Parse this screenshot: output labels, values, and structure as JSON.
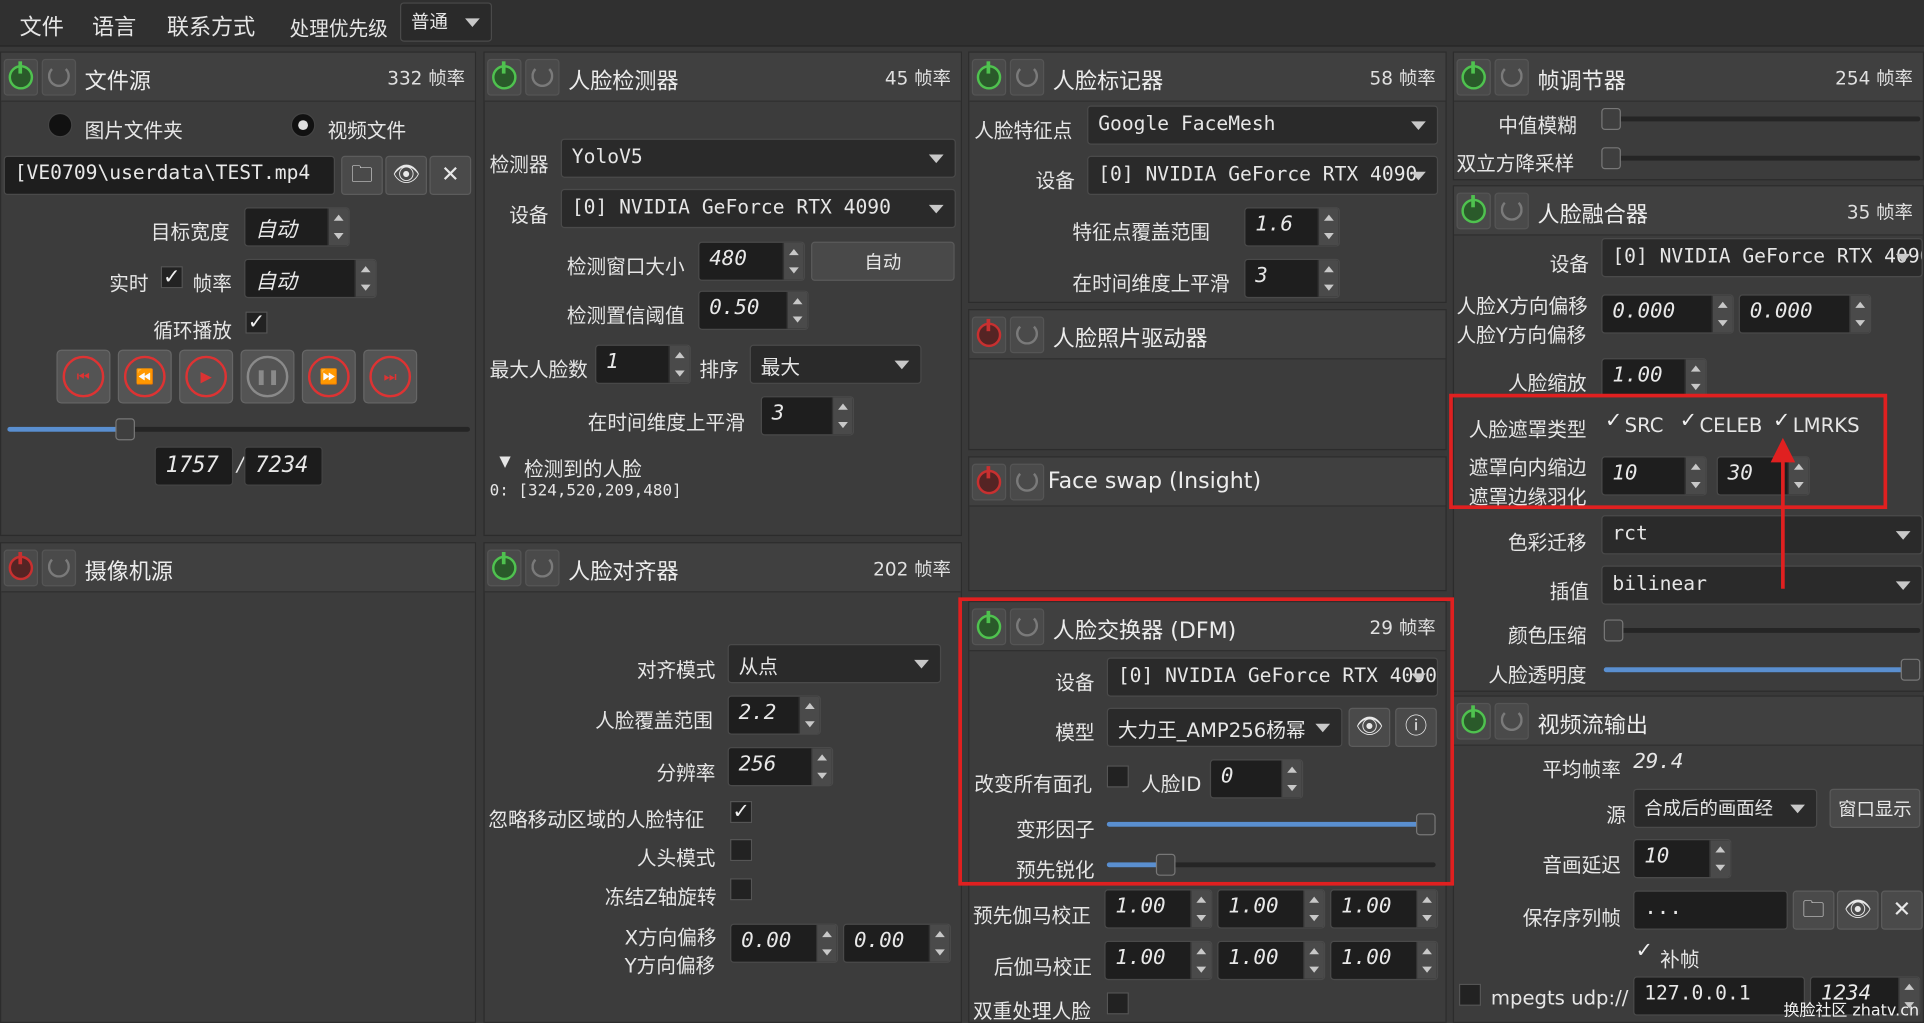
{
  "menubar": {
    "file": "文件",
    "language": "语言",
    "contact": "联系方式",
    "priority_label": "处理优先级",
    "priority_value": "普通"
  },
  "file_source": {
    "title": "文件源",
    "fps": "332 帧率",
    "radio_images": "图片文件夹",
    "radio_video": "视频文件",
    "path": "[VE0709\\userdata\\TEST.mp4",
    "target_width_label": "目标宽度",
    "target_width_value": "自动",
    "realtime_label": "实时",
    "fps_label": "帧率",
    "fps_value": "自动",
    "loop_label": "循环播放",
    "frame_current": "1757",
    "frame_sep": "/",
    "frame_total": "7234",
    "progress_fraction": 0.255
  },
  "camera_source": {
    "title": "摄像机源"
  },
  "face_detector": {
    "title": "人脸检测器",
    "fps": "45 帧率",
    "detector_label": "检测器",
    "detector_value": "YoloV5",
    "device_label": "设备",
    "device_value": "[0] NVIDIA GeForce RTX 4090",
    "window_label": "检测窗口大小",
    "window_value": "480",
    "auto_button": "自动",
    "threshold_label": "检测置信阈值",
    "threshold_value": "0.50",
    "max_faces_label": "最大人脸数",
    "max_faces_value": "1",
    "sort_label": "排序",
    "sort_value": "最大",
    "smooth_label": "在时间维度上平滑",
    "smooth_value": "3",
    "detected_label": "检测到的人脸",
    "detected_value": "0: [324,520,209,480]"
  },
  "face_aligner": {
    "title": "人脸对齐器",
    "fps": "202 帧率",
    "mode_label": "对齐模式",
    "mode_value": "从点",
    "coverage_label": "人脸覆盖范围",
    "coverage_value": "2.2",
    "resolution_label": "分辨率",
    "resolution_value": "256",
    "ignore_label": "忽略移动区域的人脸特征",
    "head_label": "人头模式",
    "freeze_label": "冻结Z轴旋转",
    "x_offset_label": "X方向偏移",
    "y_offset_label": "Y方向偏移",
    "x_offset_value": "0.00",
    "y_offset_value": "0.00"
  },
  "face_marker": {
    "title": "人脸标记器",
    "fps": "58 帧率",
    "landmarks_label": "人脸特征点",
    "landmarks_value": "Google FaceMesh",
    "device_label": "设备",
    "device_value": "[0] NVIDIA GeForce RTX 4090",
    "range_label": "特征点覆盖范围",
    "range_value": "1.6",
    "smooth_label": "在时间维度上平滑",
    "smooth_value": "3"
  },
  "face_animator": {
    "title": "人脸照片驱动器"
  },
  "face_swap_insight": {
    "title": "Face swap (Insight)"
  },
  "face_swapper_dfm": {
    "title": "人脸交换器 (DFM)",
    "fps": "29 帧率",
    "device_label": "设备",
    "device_value": "[0] NVIDIA GeForce RTX 4090",
    "model_label": "模型",
    "model_value": "大力王_AMP256杨幂",
    "swap_all_label": "改变所有面孔",
    "face_id_label": "人脸ID",
    "face_id_value": "0",
    "morph_label": "变形因子",
    "morph_fraction": 0.97,
    "sharpen_label": "预先锐化",
    "sharpen_fraction": 0.18,
    "pre_gamma_label": "预先伽马校正",
    "post_gamma_label": "后伽马校正",
    "gamma_values": [
      "1.00",
      "1.00",
      "1.00"
    ],
    "post_gamma_values": [
      "1.00",
      "1.00",
      "1.00"
    ],
    "double_label": "双重处理人脸"
  },
  "frame_adjuster": {
    "title": "帧调节器",
    "fps": "254 帧率",
    "median_label": "中值模糊",
    "bicubic_label": "双立方降采样"
  },
  "face_merger": {
    "title": "人脸融合器",
    "fps": "35 帧率",
    "device_label": "设备",
    "device_value": "[0] NVIDIA GeForce RTX 4090",
    "x_offset_label": "人脸X方向偏移",
    "y_offset_label": "人脸Y方向偏移",
    "x_offset_value": "0.000",
    "y_offset_value": "0.000",
    "scale_label": "人脸缩放",
    "scale_value": "1.00",
    "mask_type_label": "人脸遮罩类型",
    "mask_src": "SRC",
    "mask_celeb": "CELEB",
    "mask_lmrks": "LMRKS",
    "erode_label": "遮罩向内缩边",
    "blur_label": "遮罩边缘羽化",
    "erode_value": "10",
    "blur_value": "30",
    "color_transfer_label": "色彩迁移",
    "color_transfer_value": "rct",
    "interp_label": "插值",
    "interp_value": "bilinear",
    "color_compress_label": "颜色压缩",
    "opacity_label": "人脸透明度",
    "opacity_fraction": 1.0
  },
  "stream_output": {
    "title": "视频流输出",
    "avg_fps_label": "平均帧率",
    "avg_fps_value": "29.4",
    "source_label": "源",
    "source_value": "合成后的画面经",
    "window_button": "窗口显示",
    "delay_label": "音画延迟",
    "delay_value": "10",
    "save_label": "保存序列帧",
    "save_value": "...",
    "fill_label": "补帧",
    "mpegts_label": "mpegts udp://",
    "mpegts_host": "127.0.0.1",
    "mpegts_port": "1234"
  },
  "watermark": "换脸社区 zhatv.cn",
  "colors": {
    "accent": "#5a8fd0",
    "highlight": "#e02020",
    "power_on": "#4fc24f",
    "power_off": "#c83030"
  }
}
